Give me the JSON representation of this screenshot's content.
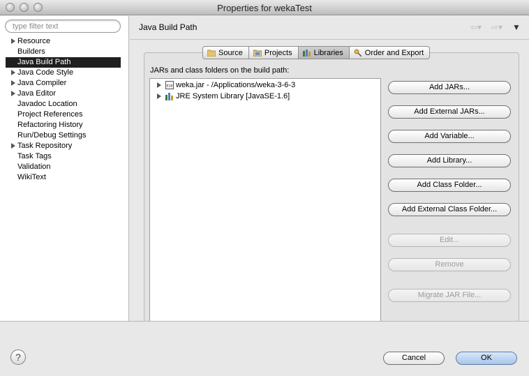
{
  "window": {
    "title": "Properties for wekaTest"
  },
  "filter": {
    "placeholder": "type filter text"
  },
  "sidebar": {
    "items": [
      {
        "label": "Resource",
        "expandable": true,
        "selected": false
      },
      {
        "label": "Builders",
        "expandable": false,
        "selected": false
      },
      {
        "label": "Java Build Path",
        "expandable": false,
        "selected": true
      },
      {
        "label": "Java Code Style",
        "expandable": true,
        "selected": false
      },
      {
        "label": "Java Compiler",
        "expandable": true,
        "selected": false
      },
      {
        "label": "Java Editor",
        "expandable": true,
        "selected": false
      },
      {
        "label": "Javadoc Location",
        "expandable": false,
        "selected": false
      },
      {
        "label": "Project References",
        "expandable": false,
        "selected": false
      },
      {
        "label": "Refactoring History",
        "expandable": false,
        "selected": false
      },
      {
        "label": "Run/Debug Settings",
        "expandable": false,
        "selected": false
      },
      {
        "label": "Task Repository",
        "expandable": true,
        "selected": false
      },
      {
        "label": "Task Tags",
        "expandable": false,
        "selected": false
      },
      {
        "label": "Validation",
        "expandable": false,
        "selected": false
      },
      {
        "label": "WikiText",
        "expandable": false,
        "selected": false
      }
    ]
  },
  "page": {
    "title": "Java Build Path"
  },
  "tabs": [
    {
      "label": "Source",
      "icon": "source-folder-icon",
      "active": false
    },
    {
      "label": "Projects",
      "icon": "projects-icon",
      "active": false
    },
    {
      "label": "Libraries",
      "icon": "libraries-icon",
      "active": true
    },
    {
      "label": "Order and Export",
      "icon": "order-export-icon",
      "active": false
    }
  ],
  "libraries": {
    "heading": "JARs and class folders on the build path:",
    "entries": [
      {
        "label": "weka.jar - /Applications/weka-3-6-3",
        "icon": "jar-icon"
      },
      {
        "label": "JRE System Library [JavaSE-1.6]",
        "icon": "library-icon"
      }
    ],
    "buttons": {
      "add_jars": "Add JARs...",
      "add_external_jars": "Add External JARs...",
      "add_variable": "Add Variable...",
      "add_library": "Add Library...",
      "add_class_folder": "Add Class Folder...",
      "add_external_class_folder": "Add External Class Folder...",
      "edit": "Edit...",
      "remove": "Remove",
      "migrate_jar": "Migrate JAR File..."
    }
  },
  "dialog": {
    "help": "?",
    "cancel": "Cancel",
    "ok": "OK"
  },
  "colors": {
    "selection": "#1f1f1f",
    "default_button": "#a8c6ea",
    "disabled_text": "#9a9a9a"
  }
}
